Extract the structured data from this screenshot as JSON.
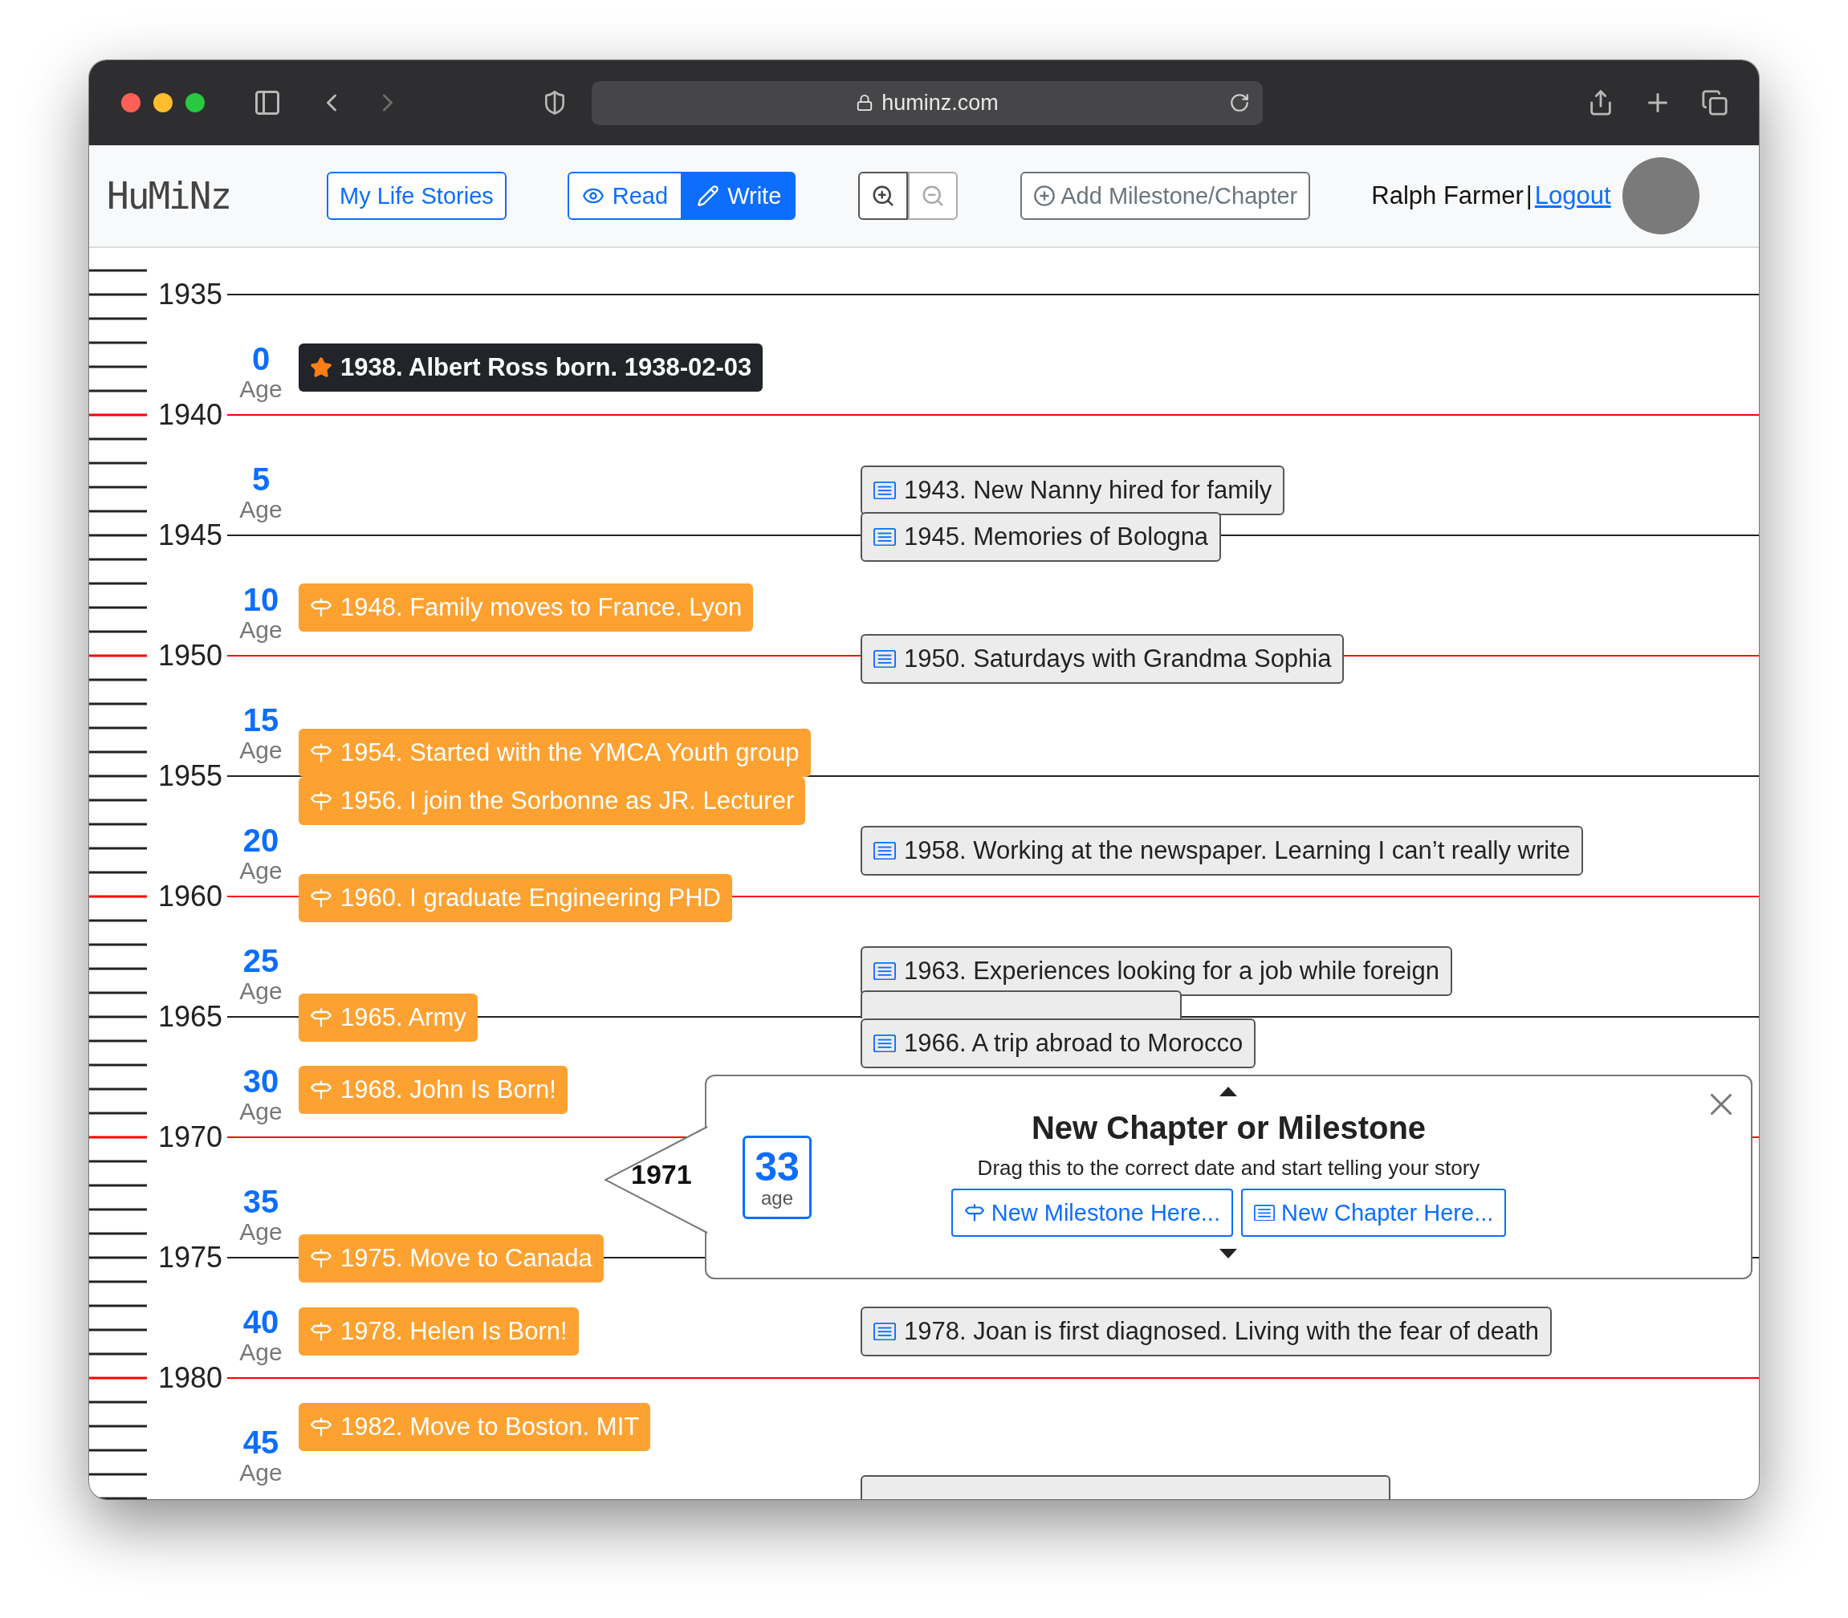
{
  "browser": {
    "url": "huminz.com",
    "back_enabled": true,
    "forward_enabled": false
  },
  "header": {
    "logo": "HuMiNz",
    "my_stories": "My Life Stories",
    "mode_tabs": [
      {
        "label": "Read",
        "kind": "read",
        "selected": false
      },
      {
        "label": "Write",
        "kind": "write",
        "selected": true
      }
    ],
    "zoom_buttons": [
      {
        "kind": "zoom-in",
        "disabled": false
      },
      {
        "kind": "zoom-out",
        "disabled": true
      }
    ],
    "add_button": "Add Milestone/Chapter",
    "user_name": "Ralph Farmer",
    "separator": "|",
    "logout": "Logout"
  },
  "timeline": {
    "years": [
      {
        "label": "1935",
        "color": "#222222"
      },
      {
        "label": "1940",
        "color": "#ff0000"
      },
      {
        "label": "1945",
        "color": "#222222"
      },
      {
        "label": "1950",
        "color": "#ff0000"
      },
      {
        "label": "1955",
        "color": "#222222"
      },
      {
        "label": "1960",
        "color": "#ff0000"
      },
      {
        "label": "1965",
        "color": "#222222"
      },
      {
        "label": "1970",
        "color": "#ff0000"
      },
      {
        "label": "1975",
        "color": "#222222"
      },
      {
        "label": "1980",
        "color": "#ff0000"
      }
    ],
    "ages": [
      {
        "value": "0",
        "label": "Age"
      },
      {
        "value": "5",
        "label": "Age"
      },
      {
        "value": "10",
        "label": "Age"
      },
      {
        "value": "15",
        "label": "Age"
      },
      {
        "value": "20",
        "label": "Age"
      },
      {
        "value": "25",
        "label": "Age"
      },
      {
        "value": "30",
        "label": "Age"
      },
      {
        "value": "35",
        "label": "Age"
      },
      {
        "value": "40",
        "label": "Age"
      },
      {
        "value": "45",
        "label": "Age"
      }
    ],
    "birth": "1938. Albert Ross born. 1938-02-03",
    "milestones": [
      "1948. Family moves to France. Lyon",
      "1954. Started with the YMCA Youth group",
      "1956. I join the Sorbonne as JR. Lecturer",
      "1960. I graduate Engineering PHD",
      "1965. Army",
      "1968. John Is Born!",
      "1975. Move to Canada",
      "1978. Helen Is Born!",
      "1982. Move to Boston. MIT"
    ],
    "chapters": [
      {
        "text": "1943. New Nanny hired for family",
        "cut": false
      },
      {
        "text": "1945. Memories of Bologna",
        "cut": false
      },
      {
        "text": "1950. Saturdays with Grandma Sophia",
        "cut": false
      },
      {
        "text": "1958. Working at the newspaper. Learning I can’t really write",
        "cut": false
      },
      {
        "text": "1963. Experiences looking for a job while foreign",
        "cut": false
      },
      {
        "cut": true
      },
      {
        "text": "1966. A trip abroad to Morocco",
        "cut": false
      },
      {
        "text": "1978. Joan is first diagnosed. Living with the fear of death",
        "cut": false
      },
      {
        "cut": true
      }
    ]
  },
  "popup": {
    "year": "1971",
    "age": "33",
    "age_label": "age",
    "title": "New Chapter or Milestone",
    "subtitle": "Drag this to the correct date and start telling your story",
    "buttons": [
      {
        "kind": "milestone",
        "label": "New Milestone Here..."
      },
      {
        "kind": "chapter",
        "label": "New Chapter Here..."
      }
    ]
  }
}
